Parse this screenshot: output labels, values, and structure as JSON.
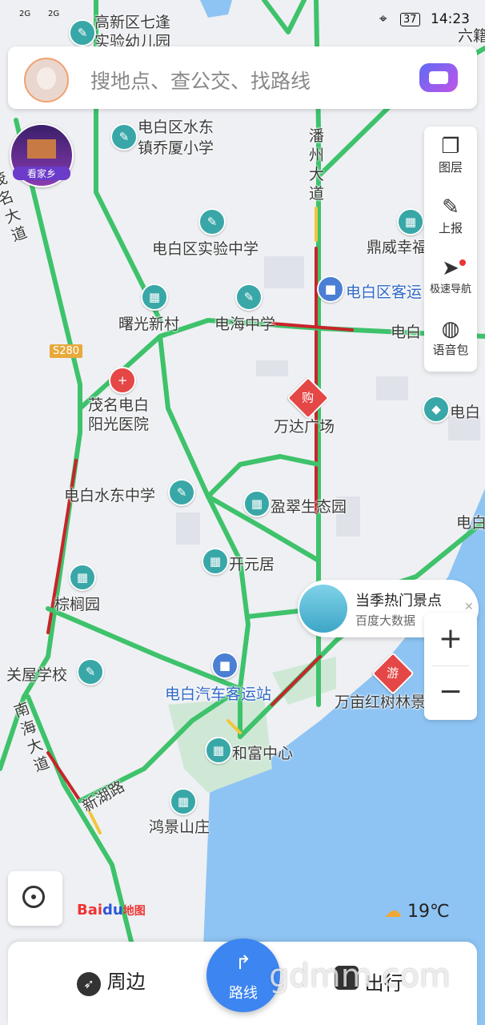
{
  "status_bar": {
    "left_text": "2G",
    "left_text2": "2G",
    "battery": "37",
    "time": "14:23"
  },
  "search": {
    "placeholder": "搜地点、查公交、找路线"
  },
  "homecoming_badge": {
    "label": "看家乡"
  },
  "right_panel": {
    "items": [
      {
        "label": "图层",
        "icon": "layers-icon"
      },
      {
        "label": "上报",
        "icon": "report-icon"
      },
      {
        "label": "极速导航",
        "icon": "navigation-icon"
      },
      {
        "label": "语音包",
        "icon": "voice-pack-icon"
      }
    ]
  },
  "map_labels": {
    "school_top": "高新区七逢\n实验幼儿园",
    "top_right_1": "六籍",
    "school_shuidong": "电白区水东\n镇乔厦小学",
    "panzhou_road": "潘州大道",
    "maoming_road": "茂名大道",
    "shiyan_middle": "电白区实验中学",
    "dingwei": "鼎威幸福",
    "dianbai_bus": "电白区客运",
    "shuguang": "曙光新村",
    "dianhai": "电海中学",
    "dianbai_road": "电白",
    "s280": "S280",
    "hospital": "茂名电白\n阳光医院",
    "wanda": "万达广场",
    "dianbai_right": "电白",
    "shuidong_middle": "电白水东中学",
    "yingcui": "盈翠生态园",
    "dianbai_right2": "电白",
    "kaiyuan": "开元居",
    "zonglu": "棕榈园",
    "guanwu_school": "关屋学校",
    "nanhai_road": "南海大道",
    "bus_station": "电白汽车客运站",
    "wanmu": "万亩红树林景",
    "hefu": "和富中心",
    "xinhu": "新湖路",
    "hongjing": "鸿景山庄",
    "shop_badge": "购",
    "tour_badge": "游"
  },
  "popup": {
    "title": "当季热门景点",
    "subtitle": "百度大数据"
  },
  "zoom": {
    "in": "+",
    "out": "−"
  },
  "logo": {
    "text_bai": "Bai",
    "text_du": "du",
    "text_map": "地图"
  },
  "weather": {
    "temp": "19℃",
    "icon": "partly-cloudy-icon"
  },
  "bottom_bar": {
    "nearby": "周边",
    "route": "路线",
    "travel": "出行"
  },
  "watermark": "gdmm.com",
  "colors": {
    "road_green": "#3ec26b",
    "road_red": "#c8242a",
    "road_yellow": "#f2c53a",
    "sea": "#8ec4f3",
    "accent_blue": "#3d85f0"
  }
}
